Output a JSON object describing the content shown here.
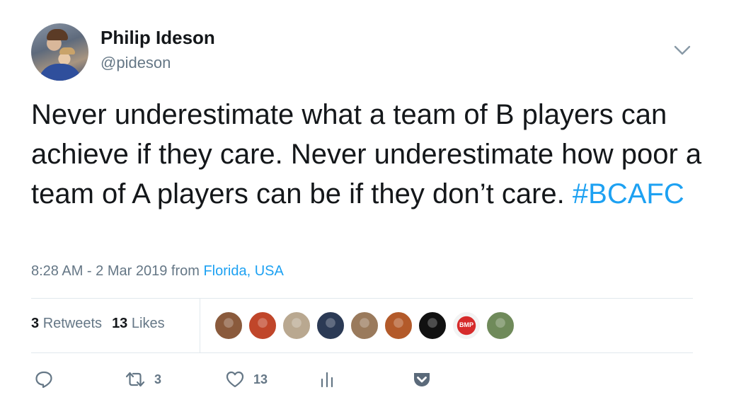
{
  "author": {
    "name": "Philip Ideson",
    "handle": "@pideson"
  },
  "tweet": {
    "text": "Never underestimate what a team of B players can achieve if they care. Never underestimate how poor a team of A players can be if they don’t care.",
    "hashtag": "#BCAFC",
    "time": "8:28 AM - 2 Mar 2019 from",
    "location": "Florida, USA"
  },
  "stats": {
    "retweets_count": "3",
    "retweets_label": "Retweets",
    "likes_count": "13",
    "likes_label": "Likes"
  },
  "likers": [
    {
      "icon": "avatar-photo",
      "color": "#8a5a3c"
    },
    {
      "icon": "avatar-photo",
      "color": "#c0462a"
    },
    {
      "icon": "avatar-photo",
      "color": "#b9a890"
    },
    {
      "icon": "avatar-photo",
      "color": "#2b3a55"
    },
    {
      "icon": "avatar-photo",
      "color": "#9a7a5c"
    },
    {
      "icon": "avatar-photo",
      "color": "#b35a2a"
    },
    {
      "icon": "avatar-photo",
      "color": "#111111"
    },
    {
      "icon": "avatar-bmp-logo",
      "color": "#d62b2b",
      "text": "BMP"
    },
    {
      "icon": "avatar-photo",
      "color": "#6f8a5a"
    }
  ],
  "actions": {
    "reply_icon": "reply-icon",
    "retweet_count": "3",
    "like_count": "13",
    "analytics_icon": "analytics-icon",
    "pocket_icon": "pocket-icon"
  },
  "colors": {
    "link": "#1da1f2",
    "secondary_text": "#657786",
    "divider": "#e1e8ed",
    "pocket": "#5b6a7a"
  }
}
